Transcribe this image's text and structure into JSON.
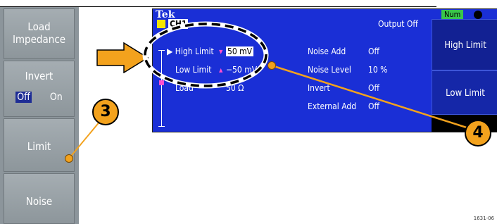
{
  "left_panel": {
    "buttons": [
      {
        "label_line1": "Load",
        "label_line2": "Impedance"
      },
      {
        "label": "Invert",
        "off_label": "Off",
        "on_label": "On"
      },
      {
        "label": "Limit"
      },
      {
        "label": "Noise"
      }
    ]
  },
  "callouts": {
    "left": "3",
    "right": "4"
  },
  "screen": {
    "brand": "Tek",
    "channel": "CH1",
    "status": "Output Off",
    "num_indicator": "Num",
    "rows_left": [
      {
        "label": "▶ High Limit",
        "marker": "▾",
        "value": "50 mV",
        "selected": true
      },
      {
        "label": "Low Limit",
        "marker": "▴",
        "value": "−50 mV",
        "selected": false
      },
      {
        "label": "Load",
        "marker": "",
        "value": "50 Ω",
        "selected": false
      }
    ],
    "rows_right": [
      {
        "label": "Noise Add",
        "value": "Off"
      },
      {
        "label": "Noise Level",
        "value": "10 %"
      },
      {
        "label": "Invert",
        "value": "Off"
      },
      {
        "label": "External Add",
        "value": "Off"
      }
    ],
    "right_buttons": [
      {
        "label": "High Limit"
      },
      {
        "label": "Low Limit"
      }
    ]
  },
  "figure_id": "1631-06",
  "colors": {
    "screen_bg": "#1a2fd6",
    "accent_orange": "#f3a21d",
    "panel_gray": "#8c959b"
  }
}
